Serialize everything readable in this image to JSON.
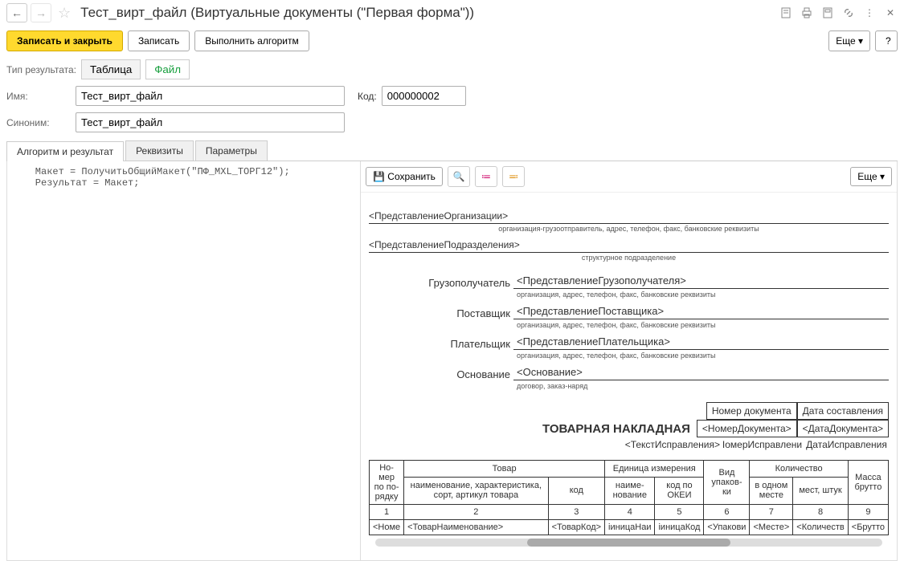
{
  "header": {
    "title": "Тест_вирт_файл (Виртуальные документы (\"Первая форма\"))"
  },
  "commands": {
    "save_close": "Записать и закрыть",
    "save": "Записать",
    "run_algorithm": "Выполнить алгоритм",
    "more": "Еще",
    "help": "?"
  },
  "result_type": {
    "label": "Тип результата:",
    "table": "Таблица",
    "file": "Файл"
  },
  "fields": {
    "name_label": "Имя:",
    "name_value": "Тест_вирт_файл",
    "code_label": "Код:",
    "code_value": "000000002",
    "synonym_label": "Синоним:",
    "synonym_value": "Тест_вирт_файл"
  },
  "tabs": {
    "algorithm": "Алгоритм и результат",
    "attributes": "Реквизиты",
    "parameters": "Параметры"
  },
  "code": "    Макет = ПолучитьОбщийМакет(\"ПФ_MXL_ТОРГ12\");\n    Результат = Макет;",
  "preview_toolbar": {
    "save": "Сохранить",
    "more": "Еще"
  },
  "document": {
    "org_representation": "<ПредставлениеОрганизации>",
    "org_caption": "организация-грузоотправитель, адрес, телефон, факс, банковские реквизиты",
    "dept_representation": "<ПредставлениеПодразделения>",
    "dept_caption": "структурное подразделение",
    "consignee_label": "Грузополучатель",
    "consignee_value": "<ПредставлениеГрузополучателя>",
    "consignee_caption": "организация, адрес, телефон, факс, банковские реквизиты",
    "supplier_label": "Поставщик",
    "supplier_value": "<ПредставлениеПоставщика>",
    "supplier_caption": "организация, адрес, телефон, факс, банковские реквизиты",
    "payer_label": "Плательщик",
    "payer_value": "<ПредставлениеПлательщика>",
    "payer_caption": "организация, адрес, телефон, факс, банковские реквизиты",
    "basis_label": "Основание",
    "basis_value": "<Основание>",
    "basis_caption": "договор, заказ-наряд",
    "doc_title": "ТОВАРНАЯ НАКЛАДНАЯ",
    "doc_num_header": "Номер документа",
    "doc_date_header": "Дата составления",
    "doc_num_value": "<НомерДокумента>",
    "doc_date_value": "<ДатаДокумента>",
    "correction_text": "<ТекстИсправления>",
    "correction_num": "ІомерИсправлени",
    "correction_date": "ДатаИсправления",
    "table": {
      "h_num": "Но-\nмер\nпо по-\nрядку",
      "h_goods": "Товар",
      "h_goods_name": "наименование, характеристика, сорт, артикул товара",
      "h_goods_code": "код",
      "h_unit": "Единица измерения",
      "h_unit_name": "наиме-\nнование",
      "h_unit_code": "код по ОКЕИ",
      "h_pack": "Вид упаков-\nки",
      "h_qty": "Количество",
      "h_qty_one": "в одном месте",
      "h_qty_places": "мест, штук",
      "h_mass": "Масса брутто",
      "n1": "1",
      "n2": "2",
      "n3": "3",
      "n4": "4",
      "n5": "5",
      "n6": "6",
      "n7": "7",
      "n8": "8",
      "n9": "9",
      "d_num": "<Номе",
      "d_name": "<ТоварНаименование>",
      "d_code": "<ТоварКод>",
      "d_unit_name": "іиницаНаи",
      "d_unit_code": "іиницаКод",
      "d_pack": "<Упакови",
      "d_qty_one": "<Месте>",
      "d_qty_places": "<Количеств",
      "d_mass": "<Брутто"
    }
  }
}
